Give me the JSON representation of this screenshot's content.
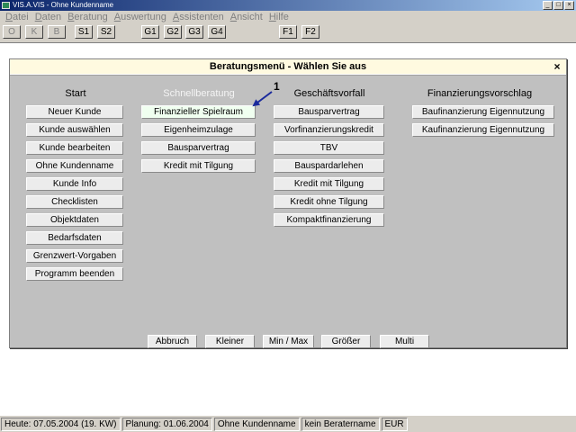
{
  "window": {
    "title": "VIS.A.VIS - Ohne Kundenname",
    "min": "_",
    "max": "□",
    "close": "×"
  },
  "menubar": [
    {
      "ul": "D",
      "rest": "atei"
    },
    {
      "ul": "D",
      "rest": "aten"
    },
    {
      "ul": "B",
      "rest": "eratung"
    },
    {
      "ul": "A",
      "rest": "uswertung"
    },
    {
      "ul": "A",
      "rest": "ssistenten"
    },
    {
      "ul": "A",
      "rest": "nsicht"
    },
    {
      "ul": "H",
      "rest": "ilfe"
    }
  ],
  "toolbar": [
    "O",
    "K",
    "B",
    "S1",
    "S2",
    "G1",
    "G2",
    "G3",
    "G4",
    "F1",
    "F2"
  ],
  "dialog": {
    "title": "Beratungsmenü - Wählen Sie aus",
    "close": "×",
    "columns": [
      {
        "heading": "Start",
        "buttons": [
          "Neuer Kunde",
          "Kunde auswählen",
          "Kunde bearbeiten",
          "Ohne Kundenname",
          "Kunde Info",
          "Checklisten",
          "Objektdaten",
          "Bedarfsdaten",
          "Grenzwert-Vorgaben",
          "Programm beenden"
        ]
      },
      {
        "heading": "Schnellberatung",
        "buttons": [
          "Finanzieller Spielraum",
          "Eigenheimzulage",
          "Bausparvertrag",
          "Kredit mit Tilgung"
        ]
      },
      {
        "heading": "Geschäftsvorfall",
        "buttons": [
          "Bausparvertrag",
          "Vorfinanzierungskredit",
          "TBV",
          "Bauspardarlehen",
          "Kredit mit Tilgung",
          "Kredit ohne Tilgung",
          "Kompaktfinanzierung"
        ]
      },
      {
        "heading": "Finanzierungsvorschlag",
        "buttons": [
          "Baufinanzierung Eigennutzung",
          "Kaufinanzierung Eigennutzung"
        ]
      }
    ],
    "bottom_buttons": [
      "Abbruch",
      "Kleiner",
      "Min / Max",
      "Größer",
      "Multi"
    ],
    "annotation_label": "1"
  },
  "statusbar": [
    "Heute: 07.05.2004 (19. KW)",
    "Planung: 01.06.2004",
    "Ohne Kundenname",
    "kein Beratername",
    "EUR"
  ]
}
